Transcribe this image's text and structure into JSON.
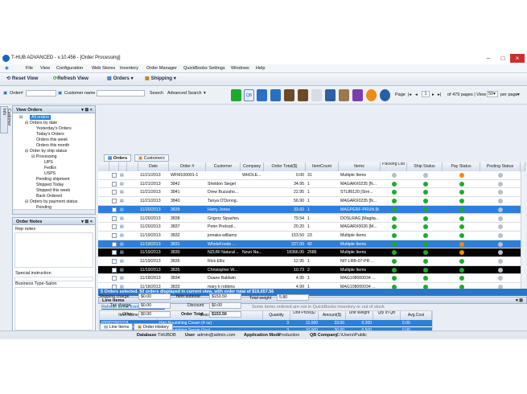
{
  "window": {
    "title": "T-HUB ADVANCED - v.10.456 - [Order Processing]"
  },
  "menu": [
    "File",
    "View",
    "Configuration",
    "Web Stores",
    "Inventory",
    "Order Manager",
    "QuickBooks Settings",
    "Windows",
    "Help"
  ],
  "toolbar": {
    "reset_view": "Reset View",
    "refresh_view": "Refresh View",
    "orders": "Orders",
    "shipping": "Shipping"
  },
  "search": {
    "order_label": "Order#",
    "customer_label": "Customer name",
    "search_label": "Search",
    "advanced_label": "Advanced Search"
  },
  "pager": {
    "page_label": "Page",
    "page_value": "1",
    "of_pages": "of 479 pages | View",
    "per_page_value": "50",
    "per_page_label": "per page"
  },
  "left": {
    "side_tab": "Customer Info",
    "view_orders_title": "View Orders",
    "tree": [
      "All orders",
      "Orders by date",
      "Yesterday's Orders",
      "Today's Orders",
      "Orders this week",
      "Orders this month",
      "Order by ship status",
      "Processing",
      "UPS",
      "FedEx",
      "USPS",
      "Pending shipment",
      "Shipped Today",
      "Shipped this week",
      "Back Ordered",
      "Orders by payment status",
      "Pending"
    ],
    "order_notes_title": "Order Notes",
    "rep_notes": "Rep notes",
    "special_instruction": "Special instruction",
    "business_type": "Business Type-Salon"
  },
  "tabs": {
    "orders": "Orders",
    "customers": "Customers",
    "line_items": "Line Items",
    "order_history": "Order History"
  },
  "grid": {
    "headers": [
      "Date",
      "Order #",
      "Customer",
      "Company",
      "Order Total($)",
      "ItemCount",
      "Items",
      "Packing List",
      "Ship Status",
      "Pay Status",
      "Posting Status"
    ],
    "rows": [
      {
        "style": "white",
        "date": "11/21/2013",
        "order": "WFM100001-1",
        "customer": "",
        "company": "WHOLE...",
        "total": "0.00",
        "count": "31",
        "items": "Multiple Items",
        "pack": "no",
        "ship": "no",
        "pay": "warn",
        "post": "no"
      },
      {
        "style": "white",
        "date": "11/21/2013",
        "order": "3842",
        "customer": "Sheldon Siegel",
        "company": "",
        "total": "34.95",
        "count": "1",
        "items": "MAGARX0235 [N...",
        "pack": "ok",
        "ship": "ok",
        "pay": "ok",
        "post": "no"
      },
      {
        "style": "white",
        "date": "11/21/2013",
        "order": "3841",
        "customer": "Drew Buzzaho...",
        "company": "",
        "total": "22.95",
        "count": "1",
        "items": "STL86120 [Stre...",
        "pack": "ok",
        "ship": "ok",
        "pay": "ok",
        "post": "no"
      },
      {
        "style": "white",
        "date": "11/21/2013",
        "order": "3840",
        "customer": "Tanya O'Donog...",
        "company": "",
        "total": "56.90",
        "count": "1",
        "items": "MAGARX0235 [N...",
        "pack": "ok",
        "ship": "ok",
        "pay": "ok",
        "post": "no"
      },
      {
        "style": "blue",
        "date": "11/20/2013",
        "order": "3839",
        "customer": "Harry Jones",
        "company": "",
        "total": "33.60",
        "count": "1",
        "items": "MAGPERF-PRUN [M...",
        "pack": "ok",
        "ship": "ok",
        "pay": "ok",
        "post": "no"
      },
      {
        "style": "white",
        "date": "11/20/2013",
        "order": "3838",
        "customer": "Grigory Sipachev",
        "company": "",
        "total": "79.54",
        "count": "1",
        "items": "DOSLRAG [Magita...",
        "pack": "ok",
        "ship": "ok",
        "pay": "ok",
        "post": "no"
      },
      {
        "style": "white",
        "date": "11/20/2013",
        "order": "3837",
        "customer": "Peter Prelozd...",
        "company": "",
        "total": "20.20",
        "count": "1",
        "items": "MAGARX0026 [M...",
        "pack": "ok",
        "ship": "ok",
        "pay": "ok",
        "post": "no"
      },
      {
        "style": "white",
        "date": "11/19/2013",
        "order": "3832",
        "customer": "jomaka williams",
        "company": "",
        "total": "153.50",
        "count": "23",
        "items": "Multiple Items",
        "pack": "ok",
        "ship": "ok",
        "pay": "ok",
        "post": "no"
      },
      {
        "style": "blue",
        "date": "11/19/2013",
        "order": "3831",
        "customer": "WholeFoods ...",
        "company": "",
        "total": "227.00",
        "count": "42",
        "items": "Multiple Items",
        "pack": "ok",
        "ship": "ok",
        "pay": "warn",
        "post": "no"
      },
      {
        "style": "black",
        "date": "11/19/2013",
        "order": "3830",
        "customer": "NZURI Natural ...",
        "company": "Nzuri Na...",
        "total": "18366.00",
        "count": "2586",
        "items": "Multiple Items",
        "pack": "ok",
        "ship": "ok",
        "pay": "warn",
        "post": "no"
      },
      {
        "style": "white",
        "date": "11/19/2013",
        "order": "3836",
        "customer": "Rick Ellis",
        "company": "",
        "total": "12.95",
        "count": "1",
        "items": "NIT-LRB-07-PR ...",
        "pack": "ok",
        "ship": "ok",
        "pay": "ok",
        "post": "no"
      },
      {
        "style": "black",
        "date": "11/19/2013",
        "order": "3835",
        "customer": "Christopher W...",
        "company": "",
        "total": "10.73",
        "count": "2",
        "items": "Multiple Items",
        "pack": "ok",
        "ship": "ok",
        "pay": "ok",
        "post": "no"
      },
      {
        "style": "white",
        "date": "11/18/2013",
        "order": "3834",
        "customer": "Duane Baldwin",
        "company": "",
        "total": "4.95",
        "count": "1",
        "items": "MAG108000034 ...",
        "pack": "ok",
        "ship": "ok",
        "pay": "ok",
        "post": "no"
      },
      {
        "style": "white",
        "date": "11/18/2013",
        "order": "3833",
        "customer": "mary k robbins",
        "company": "",
        "total": "4.99",
        "count": "1",
        "items": "MAG108000034 ...",
        "pack": "ok",
        "ship": "ok",
        "pay": "ok",
        "post": "no"
      }
    ]
  },
  "status": {
    "selected_text": "5 Orders selected. 50 orders displayed in current view, with order total of $19,657.56"
  },
  "line_items": {
    "title": "Line Items",
    "refresh_link": "Refresh items from QuickBooks.",
    "warning": "Some items ordered are not in QuickBooks inventory or out of stock",
    "headers": [
      "Item Name",
      "Description",
      "Quantity",
      "Unit Price($)",
      "Amount($)",
      "Unit Weight",
      "Qty In QB",
      "Avg.Cost"
    ],
    "rows": [
      {
        "name": "830827001018",
        "desc": "Hair Nourishing Cream (4 oz)",
        "qty": "3",
        "price": "11.000",
        "amount": "33.00",
        "weight": "0.200",
        "qb": "",
        "cost": "0.00"
      },
      {
        "name": "830827001018",
        "desc": "Hair Nourishing Serum (1oz)",
        "qty": "3",
        "price": "10.000",
        "amount": "30.00",
        "weight": "0.500",
        "qb": "",
        "cost": "0.00"
      }
    ]
  },
  "totals": {
    "shipping_label": "Shipping charge",
    "shipping": "$0.00",
    "tax_label": "Tax charge",
    "tax": "$0.00",
    "other_label": "Other",
    "other": "$0.00",
    "item_subtotal_label": "Item subtotal",
    "item_subtotal": "$153.50",
    "discount_label": "Discount",
    "discount": "$0.00",
    "order_total_label": "Order Total",
    "order_total": "$153.50",
    "total_weight_label": "Total weight",
    "total_weight": "5.80"
  },
  "bottom": {
    "database_label": "Database",
    "database": "THUBDB",
    "user_label": "User",
    "user": "admin@admin.com",
    "mode_label": "Application Mode",
    "mode": "Production",
    "qb_label": "QB Company",
    "qb": "C:\\Users\\Public"
  },
  "colors": {
    "accent": "#2e7fd8",
    "selected_black": "#050505",
    "ok": "#1faa2d",
    "warn": "#f28a10"
  }
}
